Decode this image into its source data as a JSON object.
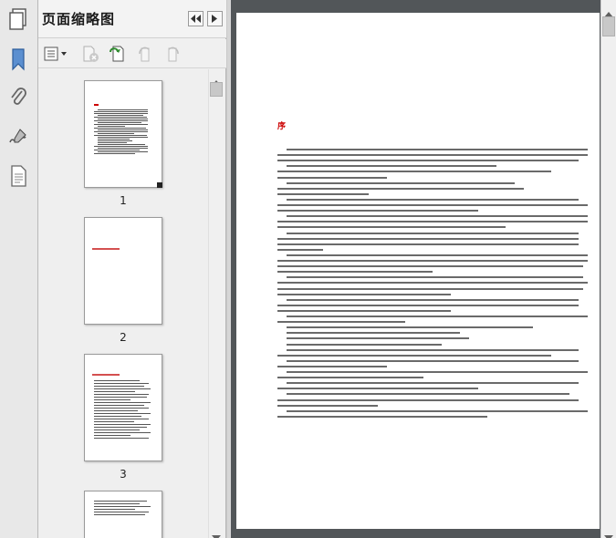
{
  "panel": {
    "title": "页面缩略图",
    "thumbnails": [
      {
        "label": "1"
      },
      {
        "label": "2"
      },
      {
        "label": "3"
      }
    ]
  },
  "document": {
    "heading": "序"
  },
  "colors": {
    "heading_red": "#cc0000",
    "viewport_bg": "#525659",
    "panel_bg": "#f0f0f0"
  },
  "icons": {
    "rail": [
      "pages-icon",
      "bookmark-icon",
      "attachment-icon",
      "signature-icon",
      "document-icon"
    ],
    "header": [
      "collapse-left-icon",
      "expand-right-icon"
    ],
    "toolbar": [
      "options-icon",
      "delete-page-icon",
      "insert-page-icon",
      "rotate-left-icon",
      "rotate-right-icon"
    ]
  }
}
